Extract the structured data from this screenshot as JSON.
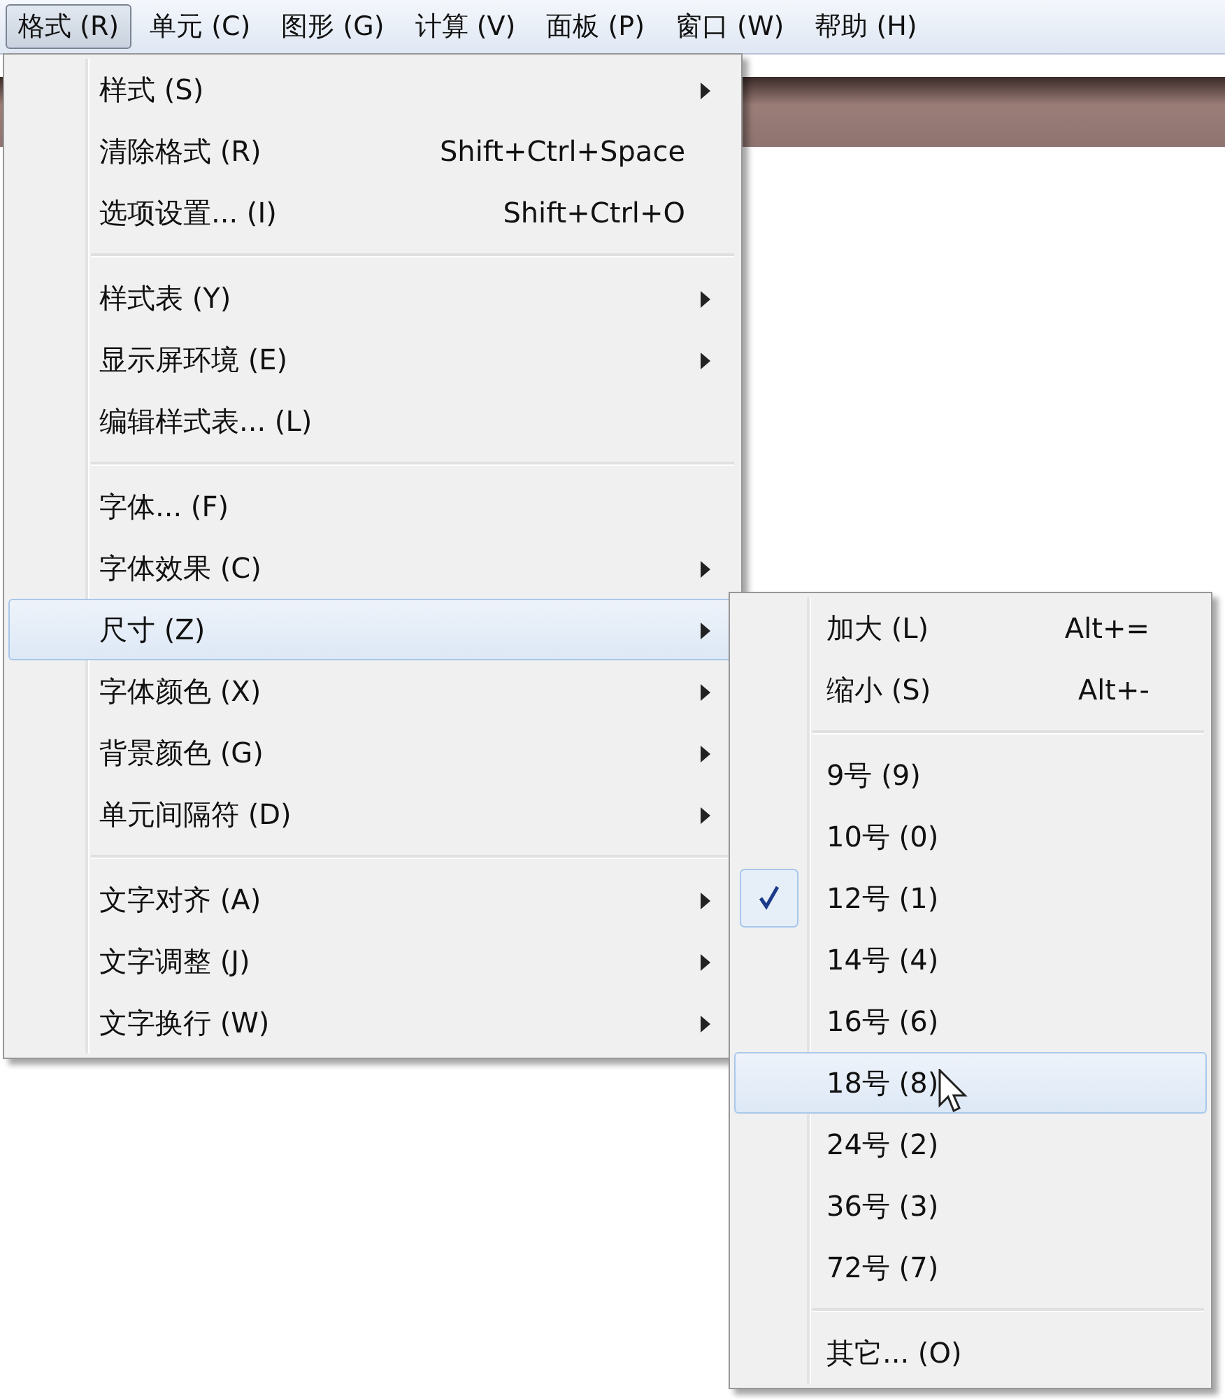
{
  "menu_bar": [
    {
      "label": "格式 (R)",
      "selected": true
    },
    {
      "label": "单元 (C)",
      "selected": false
    },
    {
      "label": "图形 (G)",
      "selected": false
    },
    {
      "label": "计算 (V)",
      "selected": false
    },
    {
      "label": "面板 (P)",
      "selected": false
    },
    {
      "label": "窗口 (W)",
      "selected": false
    },
    {
      "label": "帮助 (H)",
      "selected": false
    }
  ],
  "format_menu": {
    "sections": [
      [
        {
          "label": "样式 (S)",
          "submenu": true,
          "selected": false
        },
        {
          "label": "清除格式 (R)",
          "shortcut": "Shift+Ctrl+Space",
          "submenu": false,
          "selected": false
        },
        {
          "label": "选项设置... (I)",
          "shortcut": "Shift+Ctrl+O",
          "submenu": false,
          "selected": false
        }
      ],
      [
        {
          "label": "样式表 (Y)",
          "submenu": true,
          "selected": false
        },
        {
          "label": "显示屏环境 (E)",
          "submenu": true,
          "selected": false
        },
        {
          "label": "编辑样式表... (L)",
          "submenu": false,
          "selected": false
        }
      ],
      [
        {
          "label": "字体... (F)",
          "submenu": false,
          "selected": false
        },
        {
          "label": "字体效果 (C)",
          "submenu": true,
          "selected": false
        },
        {
          "label": "尺寸 (Z)",
          "submenu": true,
          "selected": true
        },
        {
          "label": "字体颜色 (X)",
          "submenu": true,
          "selected": false
        },
        {
          "label": "背景颜色 (G)",
          "submenu": true,
          "selected": false
        },
        {
          "label": "单元间隔符 (D)",
          "submenu": true,
          "selected": false
        }
      ],
      [
        {
          "label": "文字对齐 (A)",
          "submenu": true,
          "selected": false
        },
        {
          "label": "文字调整 (J)",
          "submenu": true,
          "selected": false
        },
        {
          "label": "文字换行 (W)",
          "submenu": true,
          "selected": false
        }
      ]
    ]
  },
  "size_submenu": {
    "sections": [
      [
        {
          "label": "加大 (L)",
          "shortcut": "Alt+=",
          "checked": false,
          "selected": false
        },
        {
          "label": "缩小 (S)",
          "shortcut": "Alt+-",
          "checked": false,
          "selected": false
        }
      ],
      [
        {
          "label": "9号 (9)",
          "checked": false,
          "selected": false
        },
        {
          "label": "10号 (0)",
          "checked": false,
          "selected": false
        },
        {
          "label": "12号 (1)",
          "checked": true,
          "selected": false
        },
        {
          "label": "14号 (4)",
          "checked": false,
          "selected": false
        },
        {
          "label": "16号 (6)",
          "checked": false,
          "selected": false
        },
        {
          "label": "18号 (8)",
          "checked": false,
          "selected": true
        },
        {
          "label": "24号 (2)",
          "checked": false,
          "selected": false
        },
        {
          "label": "36号 (3)",
          "checked": false,
          "selected": false
        },
        {
          "label": "72号 (7)",
          "checked": false,
          "selected": false
        }
      ],
      [
        {
          "label": "其它... (O)",
          "checked": false,
          "selected": false
        }
      ]
    ]
  }
}
